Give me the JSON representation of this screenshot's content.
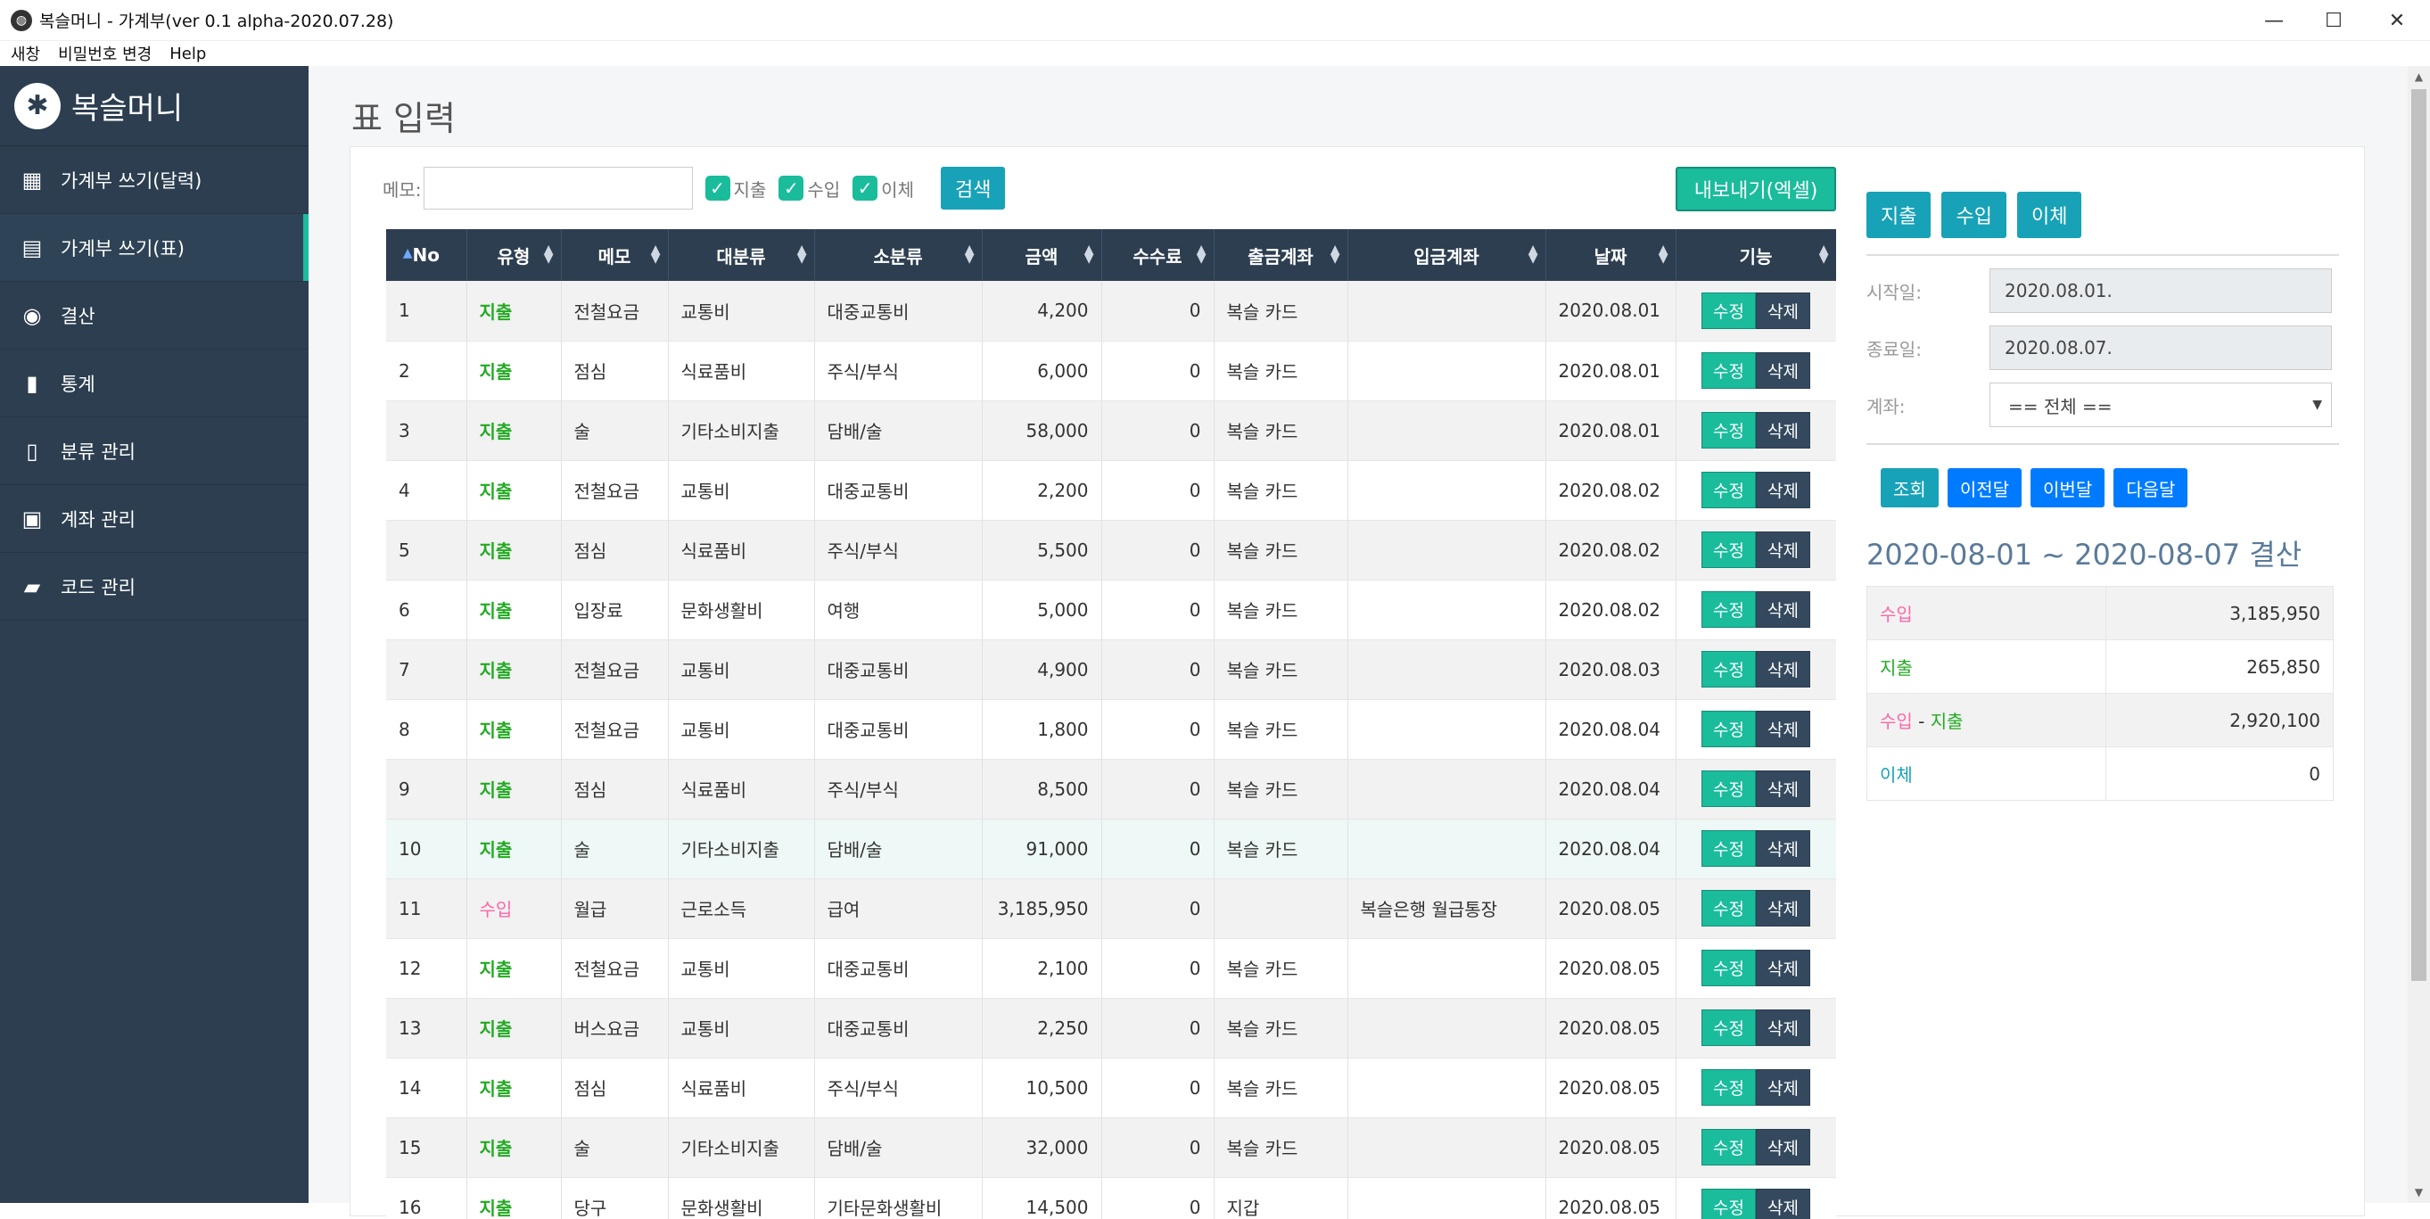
{
  "window": {
    "title": "복슬머니 - 가계부(ver 0.1 alpha-2020.07.28)",
    "minimize": "—",
    "maximize": "☐",
    "close": "✕"
  },
  "menubar": [
    "새창",
    "비밀번호 변경",
    "Help"
  ],
  "sidebar": {
    "brand": "복슬머니",
    "brand_icon": "paw-icon",
    "items": [
      {
        "label": "가계부 쓰기(달력)",
        "icon": "calendar-icon",
        "glyph": "▦"
      },
      {
        "label": "가계부 쓰기(표)",
        "icon": "table-icon",
        "glyph": "▤",
        "active": true
      },
      {
        "label": "결산",
        "icon": "database-icon",
        "glyph": "◉"
      },
      {
        "label": "통계",
        "icon": "bar-chart-icon",
        "glyph": "▮"
      },
      {
        "label": "분류 관리",
        "icon": "book-icon",
        "glyph": "▯"
      },
      {
        "label": "계좌 관리",
        "icon": "money-icon",
        "glyph": "▣"
      },
      {
        "label": "코드 관리",
        "icon": "book-open-icon",
        "glyph": "▰"
      }
    ]
  },
  "page_title": "표 입력",
  "toolbar": {
    "memo_label": "메모:",
    "memo_value": "",
    "checks": [
      {
        "label": "지출",
        "checked": true
      },
      {
        "label": "수입",
        "checked": true
      },
      {
        "label": "이체",
        "checked": true
      }
    ],
    "search_label": "검색",
    "export_label": "내보내기(엑셀)"
  },
  "table": {
    "columns": [
      "No",
      "유형",
      "메모",
      "대분류",
      "소분류",
      "금액",
      "수수료",
      "출금계좌",
      "입금계좌",
      "날짜",
      "기능"
    ],
    "edit_label": "수정",
    "delete_label": "삭제",
    "rows": [
      [
        "1",
        "지출",
        "전철요금",
        "교통비",
        "대중교통비",
        "4,200",
        "0",
        "복슬 카드",
        "",
        "2020.08.01"
      ],
      [
        "2",
        "지출",
        "점심",
        "식료품비",
        "주식/부식",
        "6,000",
        "0",
        "복슬 카드",
        "",
        "2020.08.01"
      ],
      [
        "3",
        "지출",
        "술",
        "기타소비지출",
        "담배/술",
        "58,000",
        "0",
        "복슬 카드",
        "",
        "2020.08.01"
      ],
      [
        "4",
        "지출",
        "전철요금",
        "교통비",
        "대중교통비",
        "2,200",
        "0",
        "복슬 카드",
        "",
        "2020.08.02"
      ],
      [
        "5",
        "지출",
        "점심",
        "식료품비",
        "주식/부식",
        "5,500",
        "0",
        "복슬 카드",
        "",
        "2020.08.02"
      ],
      [
        "6",
        "지출",
        "입장료",
        "문화생활비",
        "여행",
        "5,000",
        "0",
        "복슬 카드",
        "",
        "2020.08.02"
      ],
      [
        "7",
        "지출",
        "전철요금",
        "교통비",
        "대중교통비",
        "4,900",
        "0",
        "복슬 카드",
        "",
        "2020.08.03"
      ],
      [
        "8",
        "지출",
        "전철요금",
        "교통비",
        "대중교통비",
        "1,800",
        "0",
        "복슬 카드",
        "",
        "2020.08.04"
      ],
      [
        "9",
        "지출",
        "점심",
        "식료품비",
        "주식/부식",
        "8,500",
        "0",
        "복슬 카드",
        "",
        "2020.08.04"
      ],
      [
        "10",
        "지출",
        "술",
        "기타소비지출",
        "담배/술",
        "91,000",
        "0",
        "복슬 카드",
        "",
        "2020.08.04"
      ],
      [
        "11",
        "수입",
        "월급",
        "근로소득",
        "급여",
        "3,185,950",
        "0",
        "",
        "복슬은행 월급통장",
        "2020.08.05"
      ],
      [
        "12",
        "지출",
        "전철요금",
        "교통비",
        "대중교통비",
        "2,100",
        "0",
        "복슬 카드",
        "",
        "2020.08.05"
      ],
      [
        "13",
        "지출",
        "버스요금",
        "교통비",
        "대중교통비",
        "2,250",
        "0",
        "복슬 카드",
        "",
        "2020.08.05"
      ],
      [
        "14",
        "지출",
        "점심",
        "식료품비",
        "주식/부식",
        "10,500",
        "0",
        "복슬 카드",
        "",
        "2020.08.05"
      ],
      [
        "15",
        "지출",
        "술",
        "기타소비지출",
        "담배/술",
        "32,000",
        "0",
        "복슬 카드",
        "",
        "2020.08.05"
      ],
      [
        "16",
        "지출",
        "당구",
        "문화생활비",
        "기타문화생활비",
        "14,500",
        "0",
        "지갑",
        "",
        "2020.08.05"
      ]
    ]
  },
  "right": {
    "type_buttons": [
      "지출",
      "수입",
      "이체"
    ],
    "start_label": "시작일:",
    "start_value": "2020.08.01.",
    "end_label": "종료일:",
    "end_value": "2020.08.07.",
    "account_label": "계좌:",
    "account_value": "== 전체 ==",
    "nav_buttons": [
      "조회",
      "이전달",
      "이번달",
      "다음달"
    ],
    "summary_title": "2020-08-01 ~ 2020-08-07 결산",
    "summary": {
      "income_label": "수입",
      "income_value": "3,185,950",
      "expense_label": "지출",
      "expense_value": "265,850",
      "diff_label_a": "수입",
      "diff_sep": " - ",
      "diff_label_b": "지출",
      "diff_value": "2,920,100",
      "transfer_label": "이체",
      "transfer_value": "0"
    }
  },
  "colors": {
    "sidebar_bg": "#2c3e50",
    "accent_teal": "#1abc9c",
    "info": "#17a2b8",
    "primary": "#007bff",
    "income_pink": "#ff66aa",
    "expense_green": "#22aa22"
  }
}
